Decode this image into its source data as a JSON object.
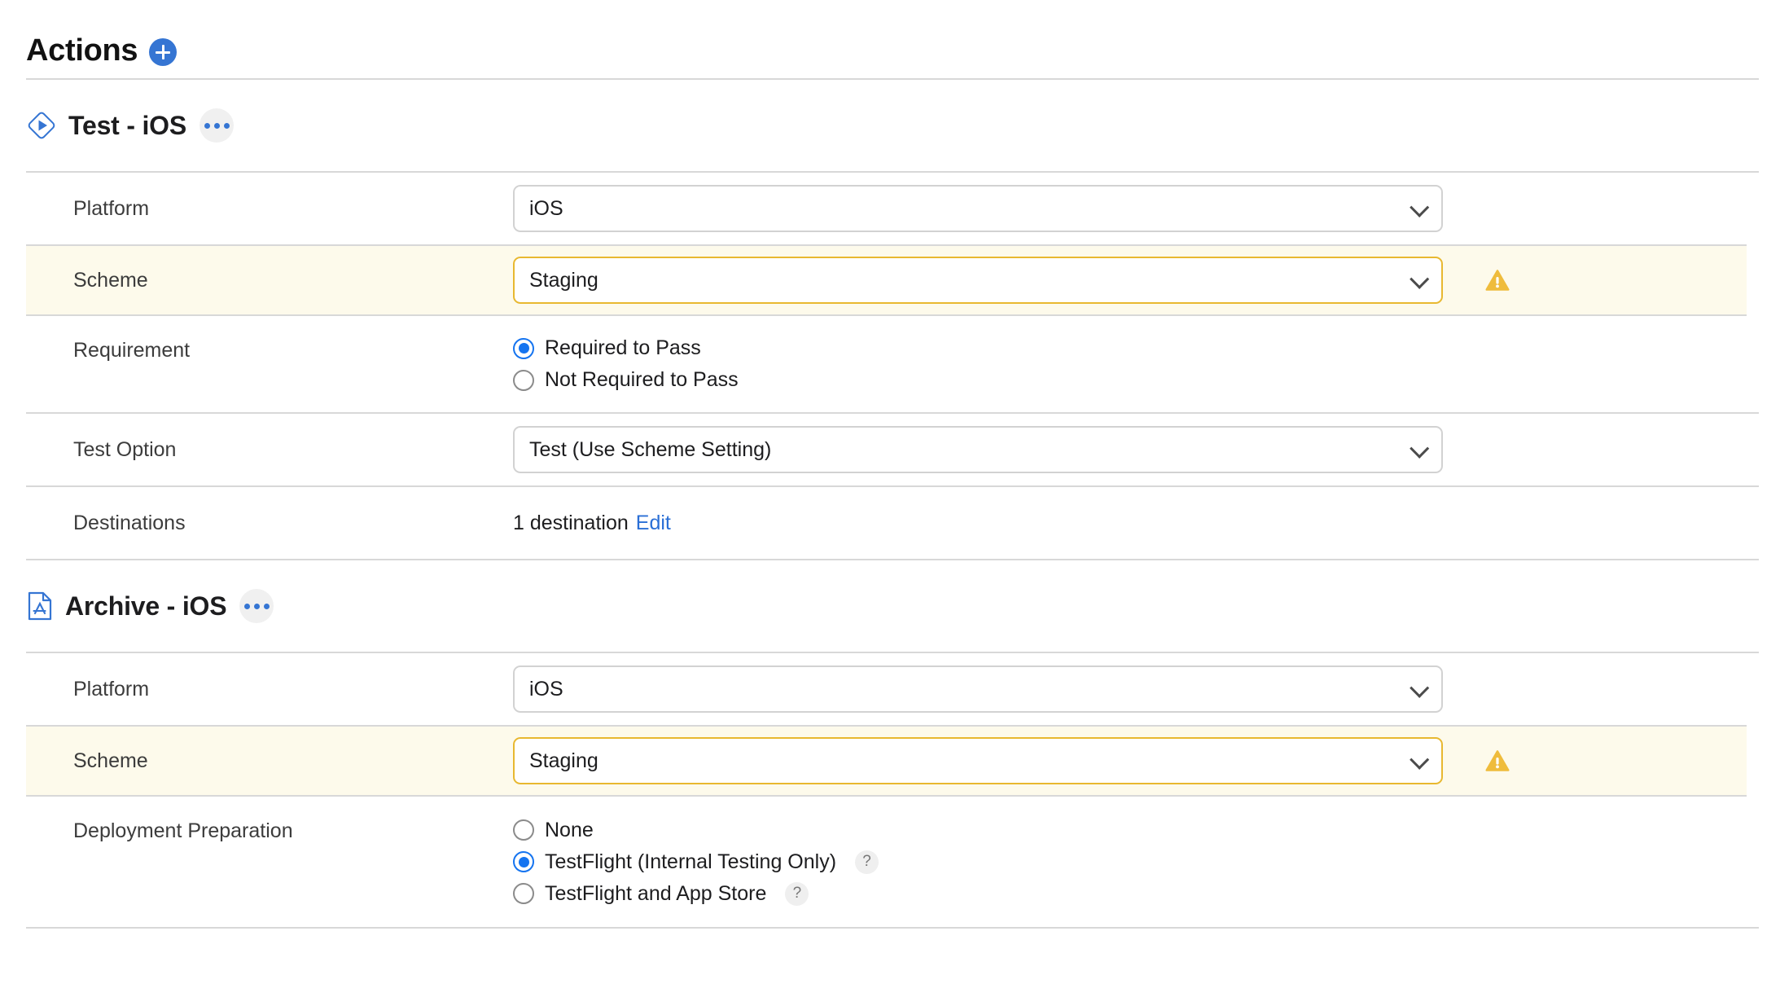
{
  "header": {
    "title": "Actions",
    "add_label": "+",
    "add_icon": "plus-circle-icon",
    "accent_color": "#3575D3"
  },
  "colors": {
    "warning_row_bg": "#FDFAEB",
    "warning_border": "#E8B830",
    "warning_icon": "#EFBC3C",
    "link": "#2A6FD6",
    "radio_on": "#1574F0",
    "divider": "#D8D8D8"
  },
  "sections": [
    {
      "id": "test-ios",
      "icon": "play-diamond-icon",
      "title": "Test - iOS",
      "menu_icon": "ellipsis-icon",
      "rows": [
        {
          "id": "platform",
          "label": "Platform",
          "type": "select",
          "value": "iOS",
          "highlight": false,
          "warning": false
        },
        {
          "id": "scheme",
          "label": "Scheme",
          "type": "select",
          "value": "Staging",
          "highlight": true,
          "warning": true,
          "warning_icon": "warning-triangle-icon"
        },
        {
          "id": "requirement",
          "label": "Requirement",
          "type": "radios",
          "options": [
            {
              "label": "Required to Pass",
              "selected": true,
              "help": false
            },
            {
              "label": "Not Required to Pass",
              "selected": false,
              "help": false
            }
          ]
        },
        {
          "id": "test-option",
          "label": "Test Option",
          "type": "select",
          "value": "Test (Use Scheme Setting)",
          "highlight": false,
          "warning": false
        },
        {
          "id": "destinations",
          "label": "Destinations",
          "type": "text-link",
          "value": "1 destination",
          "link_label": "Edit"
        }
      ]
    },
    {
      "id": "archive-ios",
      "icon": "app-store-document-icon",
      "title": "Archive - iOS",
      "menu_icon": "ellipsis-icon",
      "rows": [
        {
          "id": "platform",
          "label": "Platform",
          "type": "select",
          "value": "iOS",
          "highlight": false,
          "warning": false
        },
        {
          "id": "scheme",
          "label": "Scheme",
          "type": "select",
          "value": "Staging",
          "highlight": true,
          "warning": true,
          "warning_icon": "warning-triangle-icon"
        },
        {
          "id": "deployment-preparation",
          "label": "Deployment Preparation",
          "type": "radios",
          "options": [
            {
              "label": "None",
              "selected": false,
              "help": false
            },
            {
              "label": "TestFlight (Internal Testing Only)",
              "selected": true,
              "help": true,
              "help_label": "?"
            },
            {
              "label": "TestFlight and App Store",
              "selected": false,
              "help": true,
              "help_label": "?"
            }
          ]
        }
      ]
    }
  ]
}
